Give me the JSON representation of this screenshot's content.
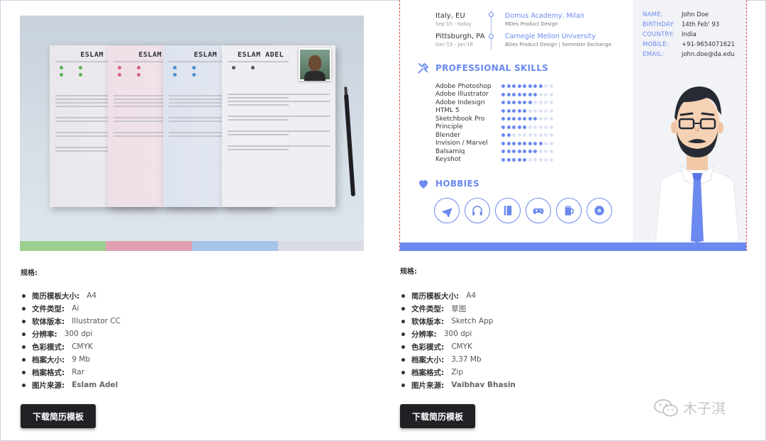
{
  "left": {
    "resume_name": "ESLAM ADEL",
    "spec_heading": "规格:",
    "specs": [
      {
        "label": "简历模板大小:",
        "value": "A4"
      },
      {
        "label": "文件类型:",
        "value": "Ai"
      },
      {
        "label": "软体版本:",
        "value": "Illustrator CC"
      },
      {
        "label": "分辨率:",
        "value": "300 dpi"
      },
      {
        "label": "色彩模式:",
        "value": "CMYK"
      },
      {
        "label": "档案大小:",
        "value": "9 Mb"
      },
      {
        "label": "档案格式:",
        "value": "Rar"
      },
      {
        "label": "图片来源:",
        "value": "Eslam Adel"
      }
    ],
    "download_label": "下载简历模板",
    "strip_colors": [
      "#9ccf8f",
      "#e1a0b1",
      "#a6c4e8",
      "#d9dde3"
    ]
  },
  "right": {
    "education": [
      {
        "place": "Italy, EU",
        "date": "Sep'15 - today",
        "school": "Domus Academy, Milan",
        "course": "MDes Product Design"
      },
      {
        "place": "Pittsburgh, PA",
        "date": "Dec'15 - Jan'16",
        "school": "Carnegie Mellon University",
        "course": "BDes Product Design | Semester Exchange"
      }
    ],
    "skills_title": "PROFESSIONAL SKILLS",
    "skills": [
      {
        "name": "Adobe Photoshop",
        "level": 8
      },
      {
        "name": "Adobe Illustrator",
        "level": 7
      },
      {
        "name": "Adobe Indesign",
        "level": 6
      },
      {
        "name": "HTML 5",
        "level": 5
      },
      {
        "name": "Sketchbook Pro",
        "level": 7
      },
      {
        "name": "Principle",
        "level": 5
      },
      {
        "name": "Blender",
        "level": 2
      },
      {
        "name": "Invision / Marvel",
        "level": 8
      },
      {
        "name": "Balsamiq",
        "level": 7
      },
      {
        "name": "Keyshot",
        "level": 5
      }
    ],
    "skills_total": 10,
    "hobbies_title": "HOBBIES",
    "hobbies": [
      "airplane-icon",
      "headphones-icon",
      "book-icon",
      "gamepad-icon",
      "beer-icon",
      "disc-icon"
    ],
    "contact": [
      {
        "key": "NAME:",
        "value": "John Doe"
      },
      {
        "key": "BIRTHDAY:",
        "value": "14th Feb' 93"
      },
      {
        "key": "COUNTRY:",
        "value": "India"
      },
      {
        "key": "MOBILE:",
        "value": "+91-9654071621"
      },
      {
        "key": "EMAIL:",
        "value": "john.doe@da.edu"
      }
    ],
    "spec_heading": "规格:",
    "specs": [
      {
        "label": "简历模板大小:",
        "value": "A4"
      },
      {
        "label": "文件类型:",
        "value": "草图"
      },
      {
        "label": "软体版本:",
        "value": "Sketch App"
      },
      {
        "label": "分辨率:",
        "value": "300 dpi"
      },
      {
        "label": "色彩模式:",
        "value": "CMYK"
      },
      {
        "label": "档案大小:",
        "value": "3,37 Mb"
      },
      {
        "label": "档案格式:",
        "value": "Zip"
      },
      {
        "label": "图片来源:",
        "value": "Vaibhav Bhasin"
      }
    ],
    "download_label": "下载简历模板",
    "accent": "#6b89ef"
  },
  "watermark": "木子淇"
}
